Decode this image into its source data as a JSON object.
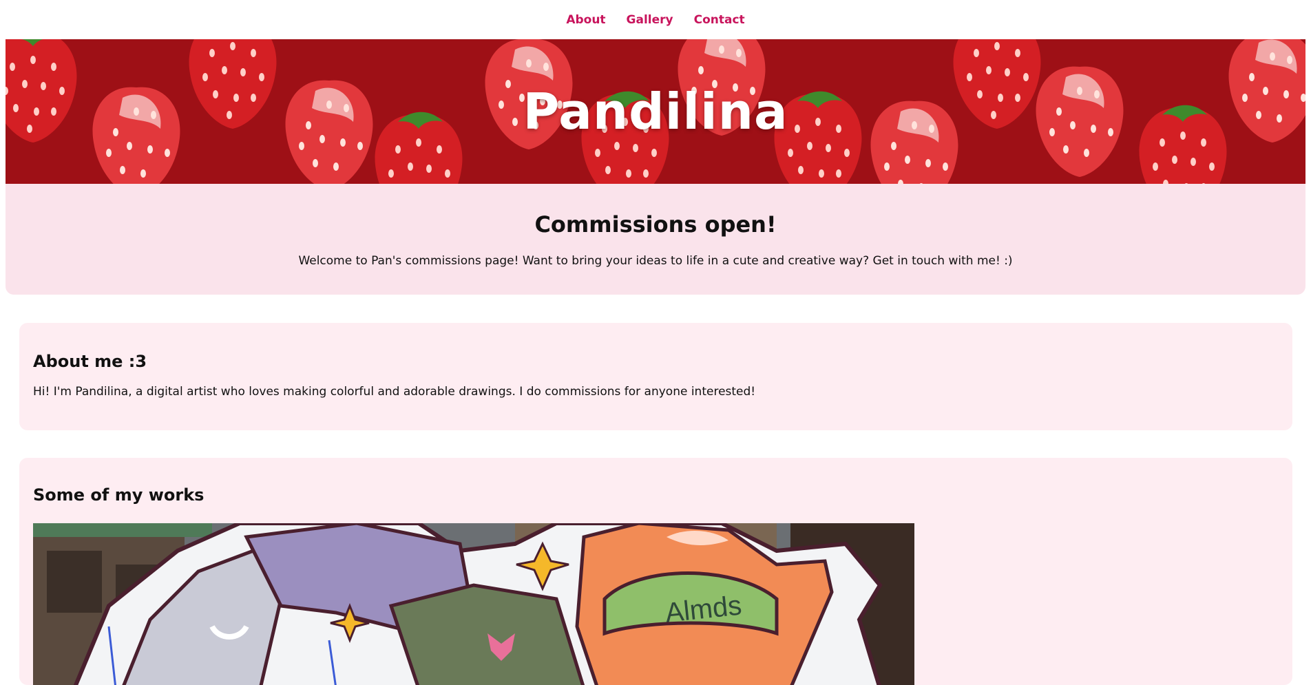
{
  "nav": {
    "items": [
      {
        "label": "About"
      },
      {
        "label": "Gallery"
      },
      {
        "label": "Contact"
      }
    ]
  },
  "hero": {
    "title": "Pandilina"
  },
  "commissions": {
    "heading": "Commissions open!",
    "text": "Welcome to Pan's commissions page! Want to bring your ideas to life in a cute and creative way? Get in touch with me! :)"
  },
  "about": {
    "heading": "About me :3",
    "text": "Hi! I'm Pandilina, a digital artist who loves making colorful and adorable drawings. I do commissions for anyone interested!"
  },
  "works": {
    "heading": "Some of my works",
    "artwork_text": "Almds"
  },
  "colors": {
    "nav_link": "#c8145c",
    "commissions_bg": "#fae3eb",
    "card_bg": "#feedf2"
  }
}
